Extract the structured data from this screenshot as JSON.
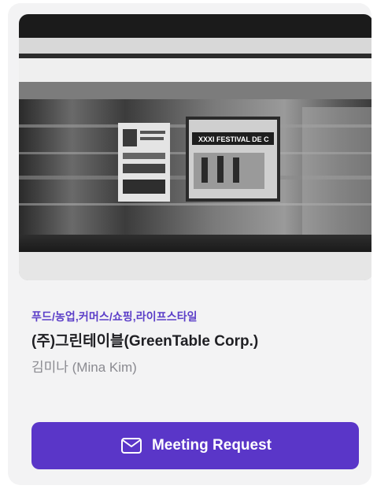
{
  "card": {
    "image_alt": "blurred subway platform with posters",
    "poster_text": "XXXI FESTIVAL DE C",
    "categories": "푸드/농업,커머스/쇼핑,라이프스타일",
    "company": "(주)그린테이블(GreenTable Corp.)",
    "contact": "김미나 (Mina Kim)",
    "button_label": "Meeting Request",
    "button_icon": "envelope-icon"
  },
  "colors": {
    "accent": "#5a36c8",
    "category_text": "#5b3ec8",
    "card_bg": "#f3f3f4"
  }
}
